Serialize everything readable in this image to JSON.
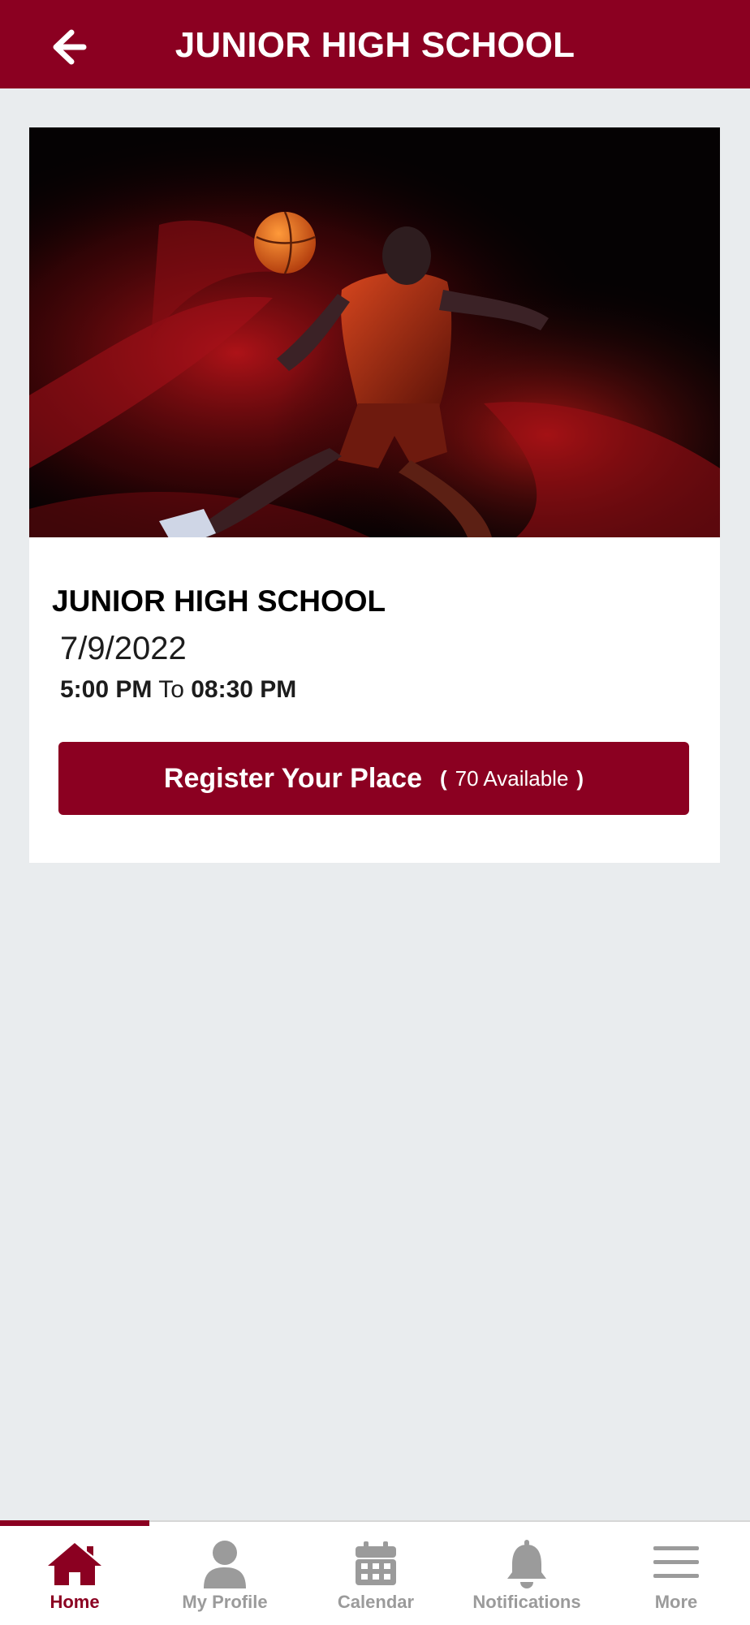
{
  "header": {
    "title": "JUNIOR HIGH SCHOOL",
    "back_icon": "arrow-left-icon"
  },
  "event": {
    "image": "basketball-player-dunk-photo",
    "title": "JUNIOR HIGH SCHOOL",
    "date": "7/9/2022",
    "start_time": "5:00 PM",
    "time_separator": "To",
    "end_time": "08:30 PM",
    "register_label": "Register Your Place",
    "paren_open": "(",
    "available_text": "70 Available",
    "paren_close": ")"
  },
  "tabbar": {
    "active_index": 0,
    "tabs": [
      {
        "label": "Home",
        "icon": "home-icon"
      },
      {
        "label": "My Profile",
        "icon": "user-icon"
      },
      {
        "label": "Calendar",
        "icon": "calendar-icon"
      },
      {
        "label": "Notifications",
        "icon": "bell-icon"
      },
      {
        "label": "More",
        "icon": "menu-icon"
      }
    ]
  },
  "colors": {
    "brand": "#8b0021",
    "background": "#e9ecee",
    "inactive_tab": "#9b9b9b"
  }
}
